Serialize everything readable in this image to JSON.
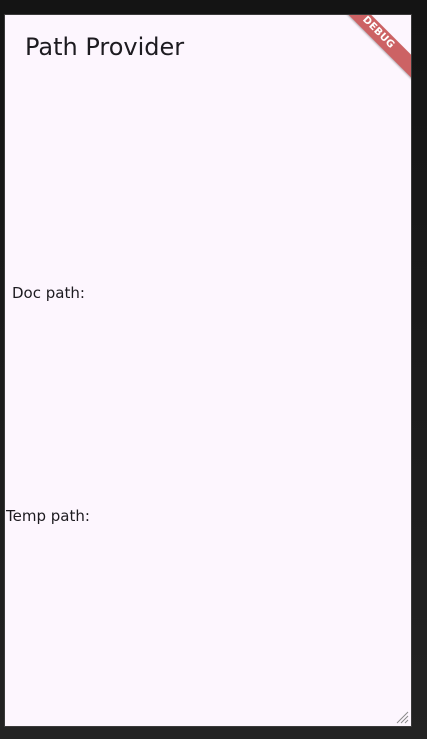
{
  "app": {
    "title": "Path Provider",
    "debug_banner": "DEBUG"
  },
  "paths": {
    "doc_label": "Doc path:",
    "temp_label": "Temp path:"
  },
  "icons": {
    "resize": "resize-grip-icon"
  }
}
